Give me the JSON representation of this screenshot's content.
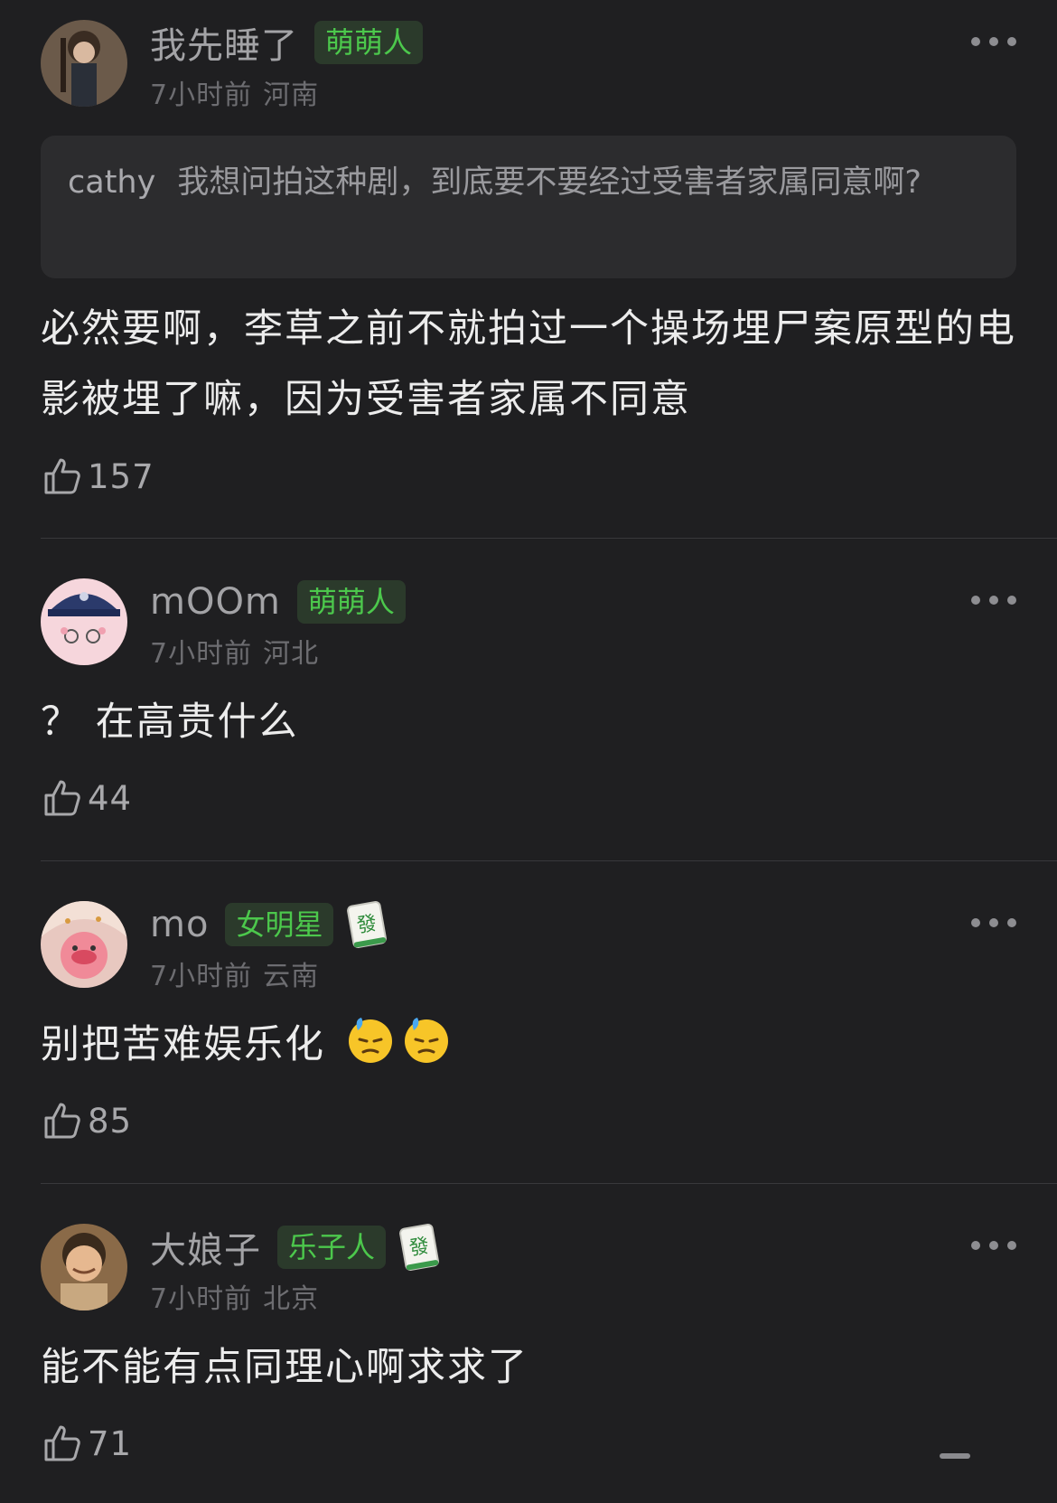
{
  "comments": [
    {
      "username": "我先睡了",
      "badge": "萌萌人",
      "time": "7小时前",
      "location": "河南",
      "quote": {
        "user": "cathy",
        "text": "我想问拍这种剧，到底要不要经过受害者家属同意啊?"
      },
      "text": "必然要啊，李草之前不就拍过一个操场埋尸案原型的电影被埋了嘛，因为受害者家属不同意",
      "likes": "157"
    },
    {
      "username": "mOOm",
      "badge": "萌萌人",
      "time": "7小时前",
      "location": "河北",
      "text": "？ 在高贵什么",
      "likes": "44"
    },
    {
      "username": "mo",
      "badge": "女明星",
      "time": "7小时前",
      "location": "云南",
      "text": "别把苦难娱乐化",
      "likes": "85",
      "tile": "mahjong-fa-tile"
    },
    {
      "username": "大娘子",
      "badge": "乐子人",
      "time": "7小时前",
      "location": "北京",
      "text": "能不能有点同理心啊求求了",
      "likes": "71",
      "tile": "mahjong-fa-tile"
    }
  ],
  "tile_glyph": "發",
  "colors": {
    "badge_text": "#4cc84c",
    "badge_bg": "#2b3a2b",
    "background": "#1f1f21"
  },
  "icons": [
    "more-icon",
    "like-icon",
    "downcast-sweat-emoji",
    "mahjong-fa-tile"
  ]
}
